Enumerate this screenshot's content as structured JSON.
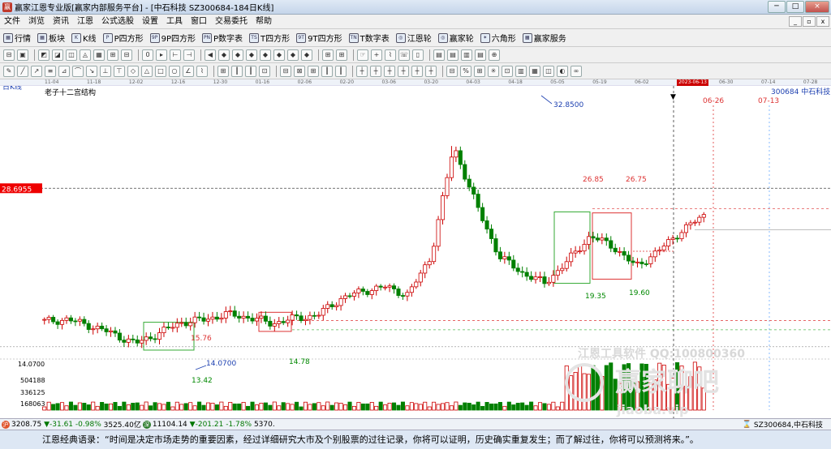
{
  "window": {
    "title": "赢家江恩专业版[赢家内部服务平台] - [中石科技  SZ300684-184日K线]",
    "app_icon": "赢",
    "buttons": [
      "─",
      "□",
      "×"
    ]
  },
  "menu": {
    "items": [
      "文件",
      "浏览",
      "资讯",
      "江恩",
      "公式选股",
      "设置",
      "工具",
      "窗口",
      "交易委托",
      "帮助"
    ],
    "subwindow_buttons": [
      "_",
      "▫",
      "x"
    ]
  },
  "toolbar1": {
    "items": [
      {
        "icon": "chart-icon",
        "glyph": "▦",
        "label": "行情"
      },
      {
        "icon": "blocks-icon",
        "glyph": "▦",
        "label": "板块"
      },
      {
        "icon": "candle-icon",
        "glyph": "K",
        "label": "K线"
      },
      {
        "icon": "p-square-icon",
        "glyph": "P",
        "label": "P四方形"
      },
      {
        "icon": "9p-square-icon",
        "glyph": "9P",
        "label": "9P四方形"
      },
      {
        "icon": "pn-table-icon",
        "glyph": "PN",
        "label": "P数字表"
      },
      {
        "icon": "t-square-icon",
        "glyph": "TS",
        "label": "T四方形"
      },
      {
        "icon": "9t-square-icon",
        "glyph": "9T",
        "label": "9T四方形"
      },
      {
        "icon": "tn-table-icon",
        "glyph": "TN",
        "label": "T数字表"
      },
      {
        "icon": "gann-wheel-icon",
        "glyph": "◎",
        "label": "江恩轮"
      },
      {
        "icon": "winner-wheel-icon",
        "glyph": "◎",
        "label": "赢家轮"
      },
      {
        "icon": "hexagon-icon",
        "glyph": "✶",
        "label": "六角形"
      },
      {
        "icon": "service-icon",
        "glyph": "▦",
        "label": "赢家服务"
      }
    ]
  },
  "toolbar2": {
    "buttons": [
      "⊟",
      "▣",
      "◩",
      "◪",
      "◫",
      "◬",
      "▦",
      "⊞",
      "⊟",
      "0",
      "▸",
      "⊢",
      "⊣",
      "◀",
      "◆",
      "◆",
      "◆",
      "◆",
      "◆",
      "◆",
      "◆",
      "⊞",
      "⊞",
      "☞",
      "+",
      "⌇",
      "☏",
      "▯",
      "▤",
      "▤",
      "▥",
      "▤",
      "⊕"
    ]
  },
  "toolbar3": {
    "buttons": [
      "✎",
      "╱",
      "↗",
      "≡",
      "⊿",
      "⌒",
      "↘",
      "⊥",
      "⊤",
      "◇",
      "△",
      "□",
      "○",
      "∠",
      "⌇",
      "⊞",
      "┃",
      "┃",
      "⊡",
      "⊟",
      "⊠",
      "⊞",
      "┃",
      "┃",
      "┼",
      "┼",
      "┼",
      "┼",
      "┼",
      "┼",
      "⊟",
      "%",
      "⊞",
      "✳",
      "⊡",
      "▥",
      "▦",
      "◫",
      "◐",
      "∞"
    ]
  },
  "time_axis": {
    "ticks": [
      "11-04",
      "11-18",
      "12-02",
      "12-16",
      "12-30",
      "01-16",
      "02-06",
      "02-20",
      "03-06",
      "03-20",
      "04-03",
      "04-18",
      "05-05",
      "05-19",
      "06-02",
      "2023-06-13",
      "06-30",
      "07-14",
      "07-28"
    ],
    "current": "2023-06-13"
  },
  "chart_labels": {
    "period": "日K线",
    "subtitle": "老子十二宫结构",
    "stock": "300684  中石科技",
    "price_tag": "28.6955",
    "vol_axis": [
      "14.0700",
      "504188",
      "336125",
      "168063"
    ],
    "future_dates": [
      "06-26",
      "07-13"
    ],
    "annotations": [
      "32.8500",
      "26.85",
      "26.75",
      "19.35",
      "19.60",
      "15.76",
      "14.78",
      "14.0700",
      "13.42"
    ],
    "watermark_line1": "江恩工具软件  QQ:100800360",
    "watermark_line2": "赢家聊吧",
    "watermark_line3": "jiaoba.vip"
  },
  "chart_data": {
    "type": "candlestick",
    "title": "老子十二宫结构",
    "symbol": "SZ300684 中石科技",
    "period": "日K线",
    "annotated_prices": {
      "high": 32.85,
      "box_high_1": 26.85,
      "box_high_2": 26.75,
      "box_low_1": 19.35,
      "box_low_2": 19.6,
      "early_box_high": 15.76,
      "early_box_2": 14.78,
      "low_line": 14.07,
      "low": 13.42,
      "reference_line": 28.6955
    },
    "ohlc_segments": [
      {
        "from": "2022-11-04",
        "to": "2022-12-01",
        "range": [
          15.0,
          16.4
        ]
      },
      {
        "from": "2022-12-02",
        "to": "2022-12-30",
        "range": [
          13.42,
          15.8
        ]
      },
      {
        "from": "2023-01-03",
        "to": "2023-02-20",
        "range": [
          14.5,
          16.6
        ]
      },
      {
        "from": "2023-02-21",
        "to": "2023-03-20",
        "range": [
          15.3,
          16.4
        ]
      },
      {
        "from": "2023-03-21",
        "to": "2023-04-18",
        "range": [
          16.0,
          19.0
        ]
      },
      {
        "from": "2023-04-19",
        "to": "2023-05-05",
        "range": [
          18.0,
          32.85
        ]
      },
      {
        "from": "2023-05-08",
        "to": "2023-06-13",
        "range": [
          19.35,
          26.85
        ]
      }
    ]
  },
  "statusbar": {
    "icon1": "沪",
    "sh_index": "3208.75",
    "sh_change": "▼-31.61",
    "sh_pct": "-0.98%",
    "sh_amount": "3525.40亿",
    "icon2": "深",
    "sz_index": "11104.14",
    "sz_change": "▼-201.21",
    "sz_pct": "-1.78%",
    "sz_amount": "5370.",
    "right_text": "SZ300684,中石科技"
  },
  "quote": {
    "text": "江恩经典语录：“时间是决定市场走势的重要因素，经过详细研究大市及个别股票的过往记录，你将可以证明，历史确实重复发生；而了解过往，你将可以预测将来。”。"
  },
  "colors": {
    "up": "#cc0000",
    "down": "#008000",
    "accent_blue": "#1c3fb0",
    "grid_red": "#d33"
  }
}
